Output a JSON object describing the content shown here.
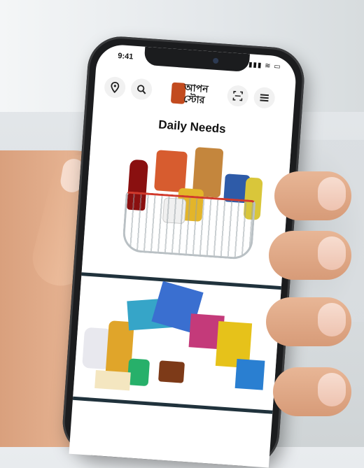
{
  "status": {
    "time": "9:41",
    "icons": "▮▮▮ ≋ ▭"
  },
  "header": {
    "logo_text": "আপন\nস্টোর"
  },
  "page": {
    "title": "Daily Needs"
  },
  "icons": {
    "location": "location-pin-icon",
    "search": "search-icon",
    "scan": "scan-icon",
    "menu": "hamburger-menu-icon"
  },
  "colors": {
    "divider": "#20323c",
    "brand": "#c24b1f"
  }
}
